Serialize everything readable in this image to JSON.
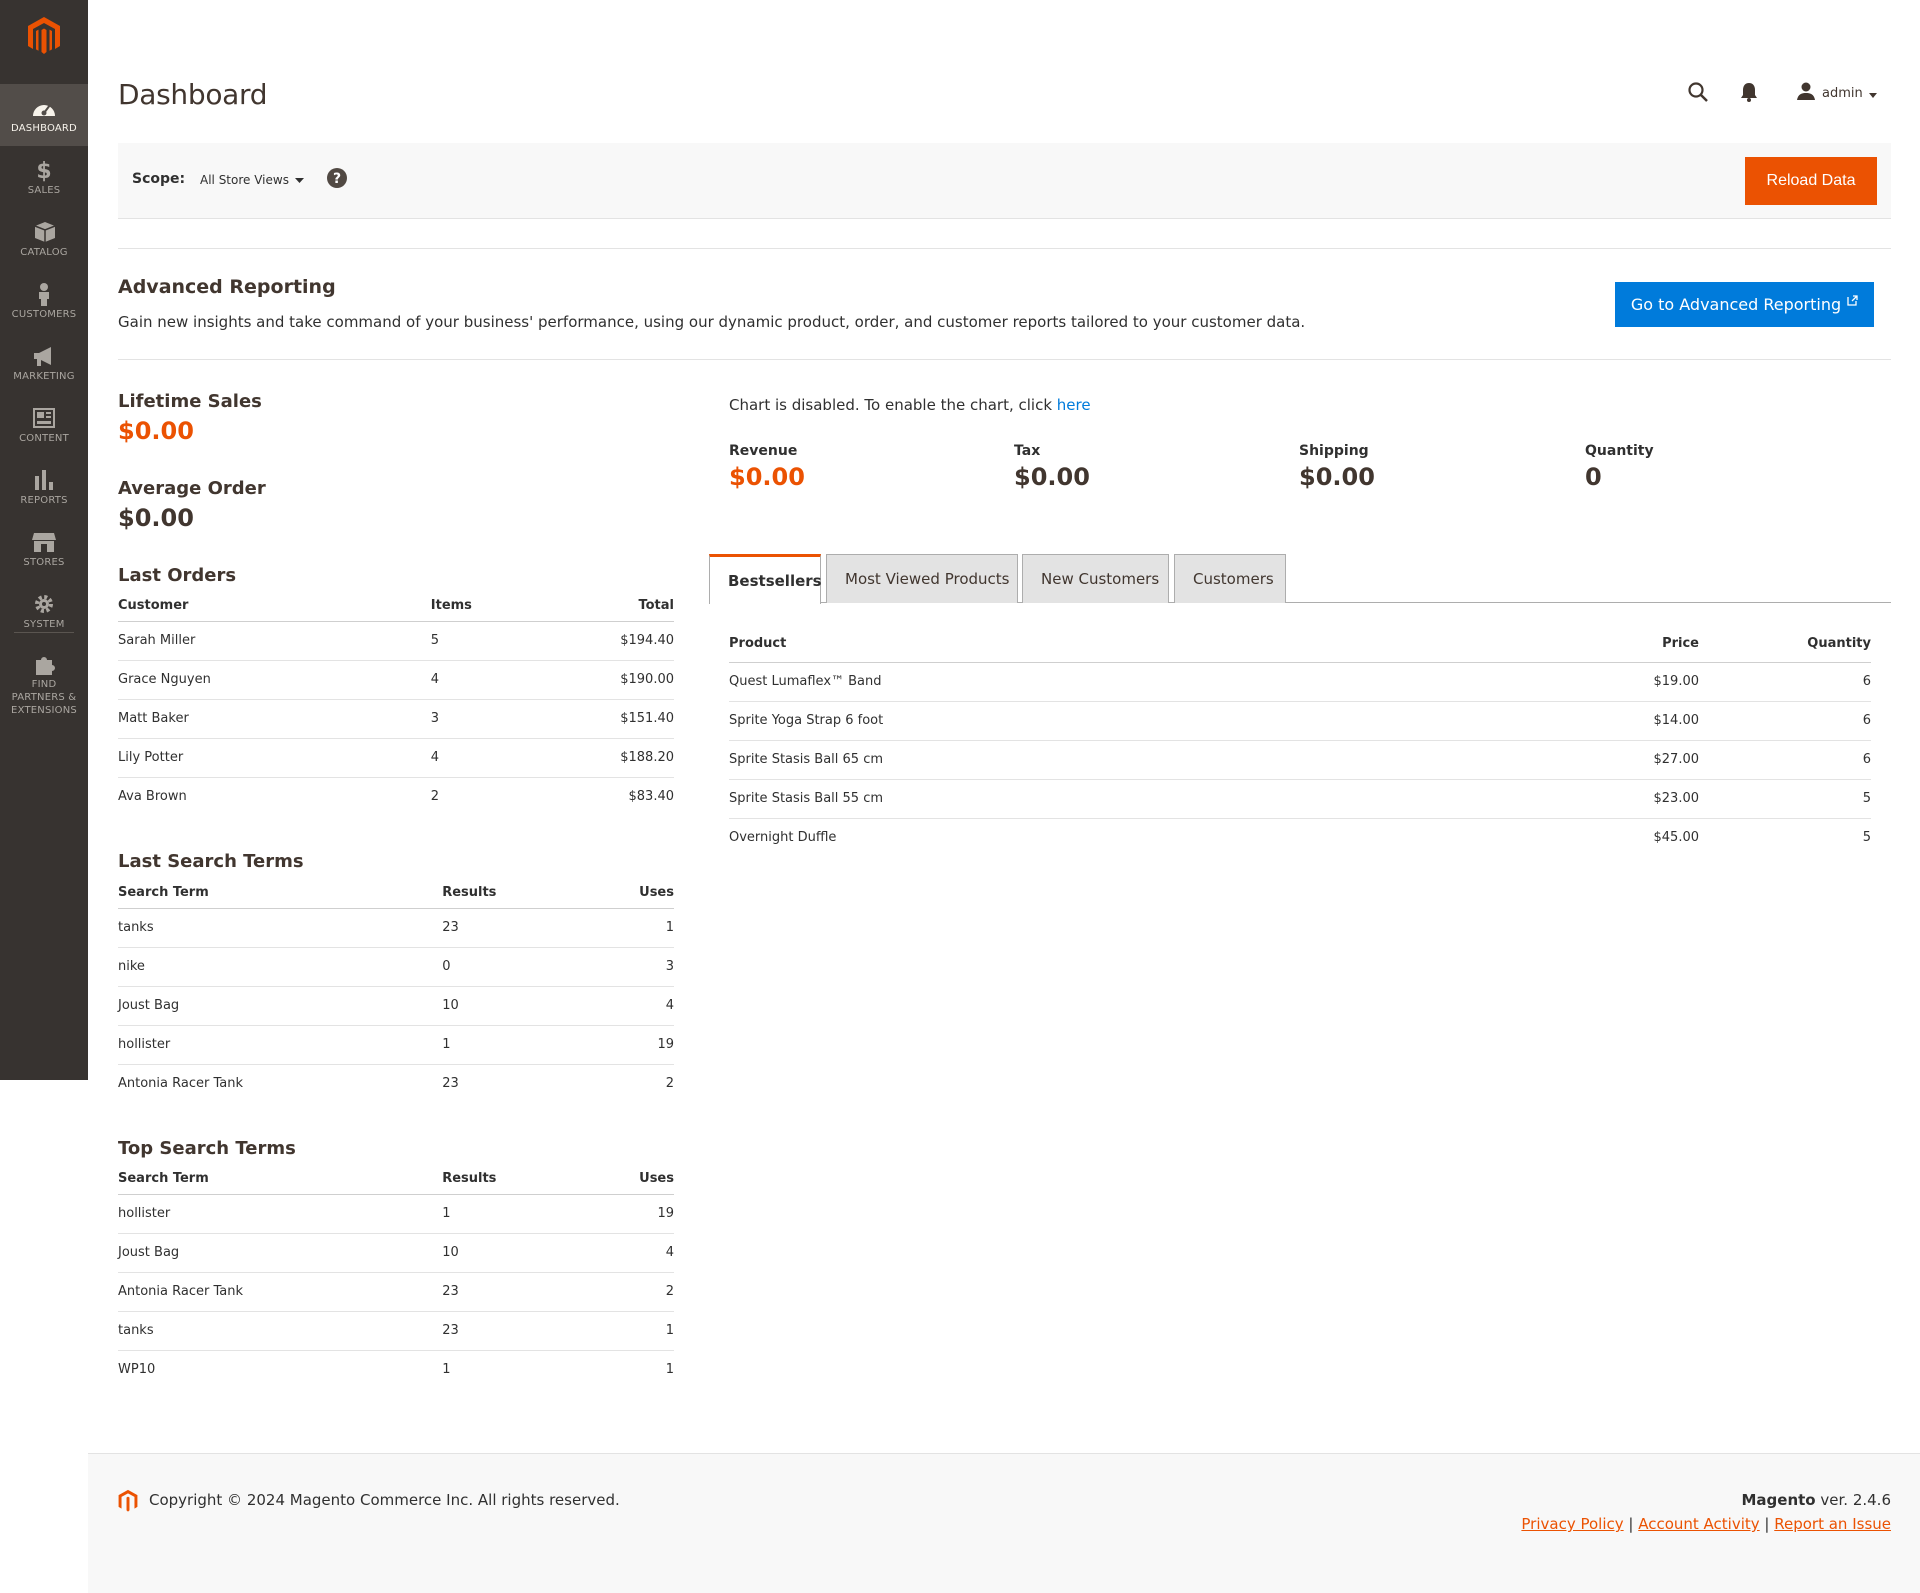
{
  "colors": {
    "accent": "#eb5202",
    "link": "#007bdb",
    "sidebar": "#373330"
  },
  "sidebar": {
    "items": [
      {
        "label": "DASHBOARD",
        "icon": "dashboard-icon"
      },
      {
        "label": "SALES",
        "icon": "dollar-icon"
      },
      {
        "label": "CATALOG",
        "icon": "box-icon"
      },
      {
        "label": "CUSTOMERS",
        "icon": "person-icon"
      },
      {
        "label": "MARKETING",
        "icon": "megaphone-icon"
      },
      {
        "label": "CONTENT",
        "icon": "layout-icon"
      },
      {
        "label": "REPORTS",
        "icon": "bar-chart-icon"
      },
      {
        "label": "STORES",
        "icon": "store-icon"
      },
      {
        "label": "SYSTEM",
        "icon": "gear-icon"
      },
      {
        "label": "FIND PARTNERS & EXTENSIONS",
        "icon": "puzzle-icon"
      }
    ]
  },
  "header": {
    "title": "Dashboard",
    "user": "admin"
  },
  "scope": {
    "label": "Scope:",
    "selected": "All Store Views",
    "reload": "Reload Data"
  },
  "advanced": {
    "title": "Advanced Reporting",
    "description": "Gain new insights and take command of your business' performance, using our dynamic product, order, and customer reports tailored to your customer data.",
    "button": "Go to Advanced Reporting"
  },
  "lifetime": {
    "title": "Lifetime Sales",
    "value": "$0.00"
  },
  "average": {
    "title": "Average Order",
    "value": "$0.00"
  },
  "last_orders": {
    "title": "Last Orders",
    "headers": [
      "Customer",
      "Items",
      "Total"
    ],
    "rows": [
      [
        "Sarah Miller",
        "5",
        "$194.40"
      ],
      [
        "Grace Nguyen",
        "4",
        "$190.00"
      ],
      [
        "Matt Baker",
        "3",
        "$151.40"
      ],
      [
        "Lily Potter",
        "4",
        "$188.20"
      ],
      [
        "Ava Brown",
        "2",
        "$83.40"
      ]
    ]
  },
  "last_search": {
    "title": "Last Search Terms",
    "headers": [
      "Search Term",
      "Results",
      "Uses"
    ],
    "rows": [
      [
        "tanks",
        "23",
        "1"
      ],
      [
        "nike",
        "0",
        "3"
      ],
      [
        "Joust Bag",
        "10",
        "4"
      ],
      [
        "hollister",
        "1",
        "19"
      ],
      [
        "Antonia Racer Tank",
        "23",
        "2"
      ]
    ]
  },
  "top_search": {
    "title": "Top Search Terms",
    "headers": [
      "Search Term",
      "Results",
      "Uses"
    ],
    "rows": [
      [
        "hollister",
        "1",
        "19"
      ],
      [
        "Joust Bag",
        "10",
        "4"
      ],
      [
        "Antonia Racer Tank",
        "23",
        "2"
      ],
      [
        "tanks",
        "23",
        "1"
      ],
      [
        "WP10",
        "1",
        "1"
      ]
    ]
  },
  "chart": {
    "message": "Chart is disabled. To enable the chart, click ",
    "link": "here"
  },
  "totals": {
    "revenue": {
      "label": "Revenue",
      "value": "$0.00"
    },
    "tax": {
      "label": "Tax",
      "value": "$0.00"
    },
    "shipping": {
      "label": "Shipping",
      "value": "$0.00"
    },
    "quantity": {
      "label": "Quantity",
      "value": "0"
    }
  },
  "tabs": [
    "Bestsellers",
    "Most Viewed Products",
    "New Customers",
    "Customers"
  ],
  "bestsellers": {
    "headers": [
      "Product",
      "Price",
      "Quantity"
    ],
    "rows": [
      [
        "Quest Lumaflex™ Band",
        "$19.00",
        "6"
      ],
      [
        "Sprite Yoga Strap 6 foot",
        "$14.00",
        "6"
      ],
      [
        "Sprite Stasis Ball 65 cm",
        "$27.00",
        "6"
      ],
      [
        "Sprite Stasis Ball 55 cm",
        "$23.00",
        "5"
      ],
      [
        "Overnight Duffle",
        "$45.00",
        "5"
      ]
    ]
  },
  "footer": {
    "copyright": "Copyright © 2024 Magento Commerce Inc. All rights reserved.",
    "brand": "Magento",
    "version": " ver. 2.4.6",
    "links": [
      "Privacy Policy",
      "Account Activity",
      "Report an Issue"
    ],
    "sep": " | "
  }
}
